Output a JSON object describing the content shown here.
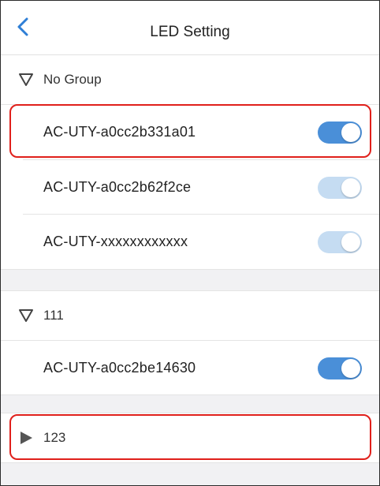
{
  "header": {
    "title": "LED Setting",
    "back_icon": "chevron-left-icon",
    "accent": "#2f7fd6"
  },
  "groups": [
    {
      "name": "No Group",
      "expanded": true,
      "devices": [
        {
          "name": "AC-UTY-a0cc2b331a01",
          "toggle_on": true,
          "enabled": true
        },
        {
          "name": "AC-UTY-a0cc2b62f2ce",
          "toggle_on": true,
          "enabled": false
        },
        {
          "name": "AC-UTY-xxxxxxxxxxxx",
          "toggle_on": true,
          "enabled": false
        }
      ]
    },
    {
      "name": "111",
      "expanded": true,
      "devices": [
        {
          "name": "AC-UTY-a0cc2be14630",
          "toggle_on": true,
          "enabled": true
        }
      ]
    },
    {
      "name": "123",
      "expanded": false,
      "devices": []
    }
  ],
  "colors": {
    "toggle_on": "#4a8fd8",
    "toggle_disabled": "#c5dcf2",
    "highlight": "#e0201b",
    "section_gap": "#f1f1f3"
  }
}
